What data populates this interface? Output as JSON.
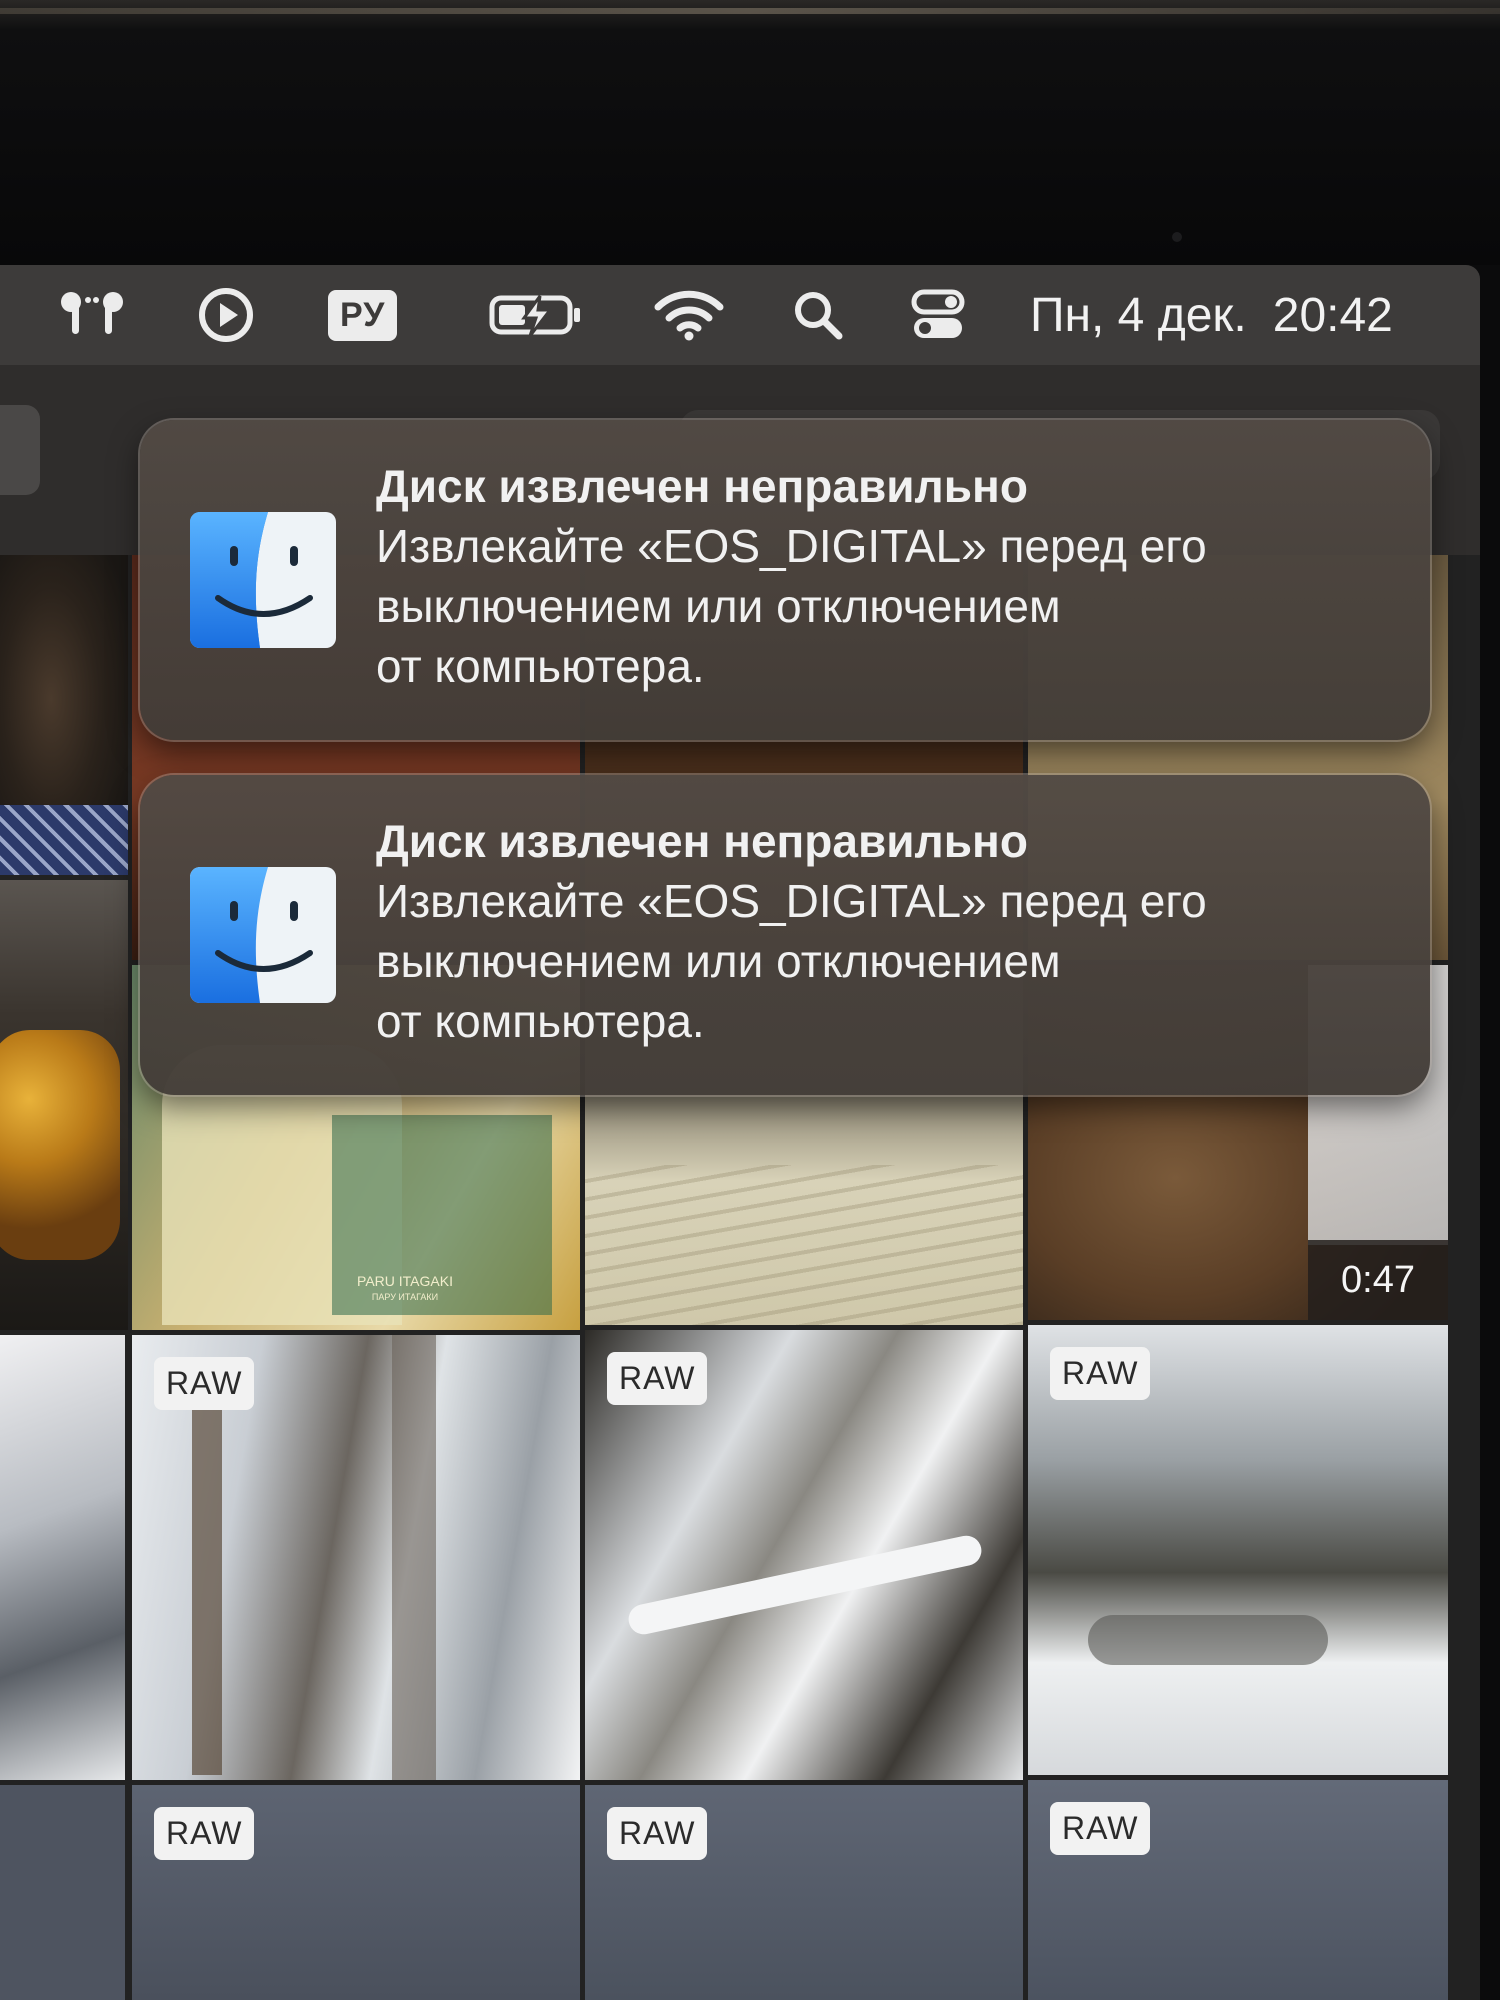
{
  "menu_bar": {
    "icons": [
      "airpods-icon",
      "play-circle-icon",
      "battery-charging-icon",
      "wifi-icon",
      "search-icon",
      "control-center-icon"
    ],
    "input_language": "РУ",
    "date": "Пн, 4 дек.",
    "time": "20:42"
  },
  "notifications": [
    {
      "app_icon": "finder-icon",
      "title": "Диск извлечен неправильно",
      "body_lines": [
        "Извлекайте «EOS_DIGITAL» перед его",
        "выключением или отключением",
        "от компьютера."
      ]
    },
    {
      "app_icon": "finder-icon",
      "title": "Диск извлечен неправильно",
      "body_lines": [
        "Извлекайте «EOS_DIGITAL» перед его",
        "выключением или отключением",
        "от компьютера."
      ]
    }
  ],
  "photo_grid": {
    "video_duration": "0:47",
    "book_cover_text": [
      "PARU ITAGAKI",
      "ПАРУ ИТАГАКИ"
    ],
    "raw_badges": [
      "RAW",
      "RAW",
      "RAW",
      "RAW",
      "RAW",
      "RAW"
    ]
  }
}
